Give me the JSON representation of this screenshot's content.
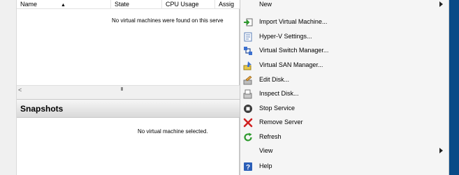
{
  "vm_list": {
    "columns": [
      "Name",
      "State",
      "CPU Usage",
      "Assig"
    ],
    "empty_message": "No virtual machines were found on this serve"
  },
  "scrollbar": {
    "left_arrow": "<",
    "thumb_grip": "III"
  },
  "snapshots": {
    "title": "Snapshots",
    "empty_message": "No virtual machine selected."
  },
  "menu": {
    "items": [
      {
        "label": "New",
        "icon": "none",
        "submenu": true
      },
      {
        "label": "Import Virtual Machine...",
        "icon": "import-icon",
        "submenu": false
      },
      {
        "label": "Hyper-V Settings...",
        "icon": "settings-icon",
        "submenu": false
      },
      {
        "label": "Virtual Switch Manager...",
        "icon": "switch-manager-icon",
        "submenu": false
      },
      {
        "label": "Virtual SAN Manager...",
        "icon": "san-manager-icon",
        "submenu": false
      },
      {
        "label": "Edit Disk...",
        "icon": "edit-disk-icon",
        "submenu": false
      },
      {
        "label": "Inspect Disk...",
        "icon": "inspect-disk-icon",
        "submenu": false
      },
      {
        "label": "Stop Service",
        "icon": "stop-icon",
        "submenu": false
      },
      {
        "label": "Remove Server",
        "icon": "remove-icon",
        "submenu": false
      },
      {
        "label": "Refresh",
        "icon": "refresh-icon",
        "submenu": false
      },
      {
        "label": "View",
        "icon": "none",
        "submenu": true
      },
      {
        "label": "Help",
        "icon": "help-icon",
        "submenu": false
      }
    ]
  },
  "colors": {
    "accent_edge": "#0a4a87",
    "menu_bg": "#f5f5f5"
  }
}
